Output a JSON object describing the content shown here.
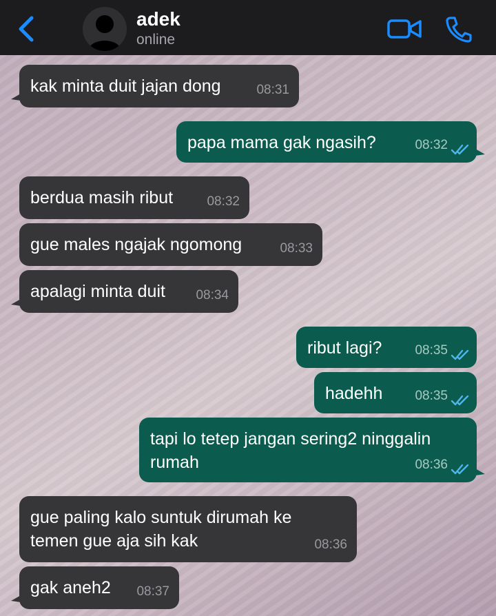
{
  "header": {
    "contact_name": "adek",
    "status": "online"
  },
  "colors": {
    "incoming_bubble": "#363638",
    "outgoing_bubble": "#0b5c4e",
    "accent": "#1a8cff",
    "read_tick": "#4fb6ec"
  },
  "messages": [
    {
      "direction": "in",
      "text": "kak minta duit jajan dong",
      "time": "08:31"
    },
    {
      "direction": "out",
      "text": "papa mama gak ngasih?",
      "time": "08:32",
      "status": "read"
    },
    {
      "direction": "in",
      "text": "berdua masih ribut",
      "time": "08:32"
    },
    {
      "direction": "in",
      "text": "gue males ngajak ngomong",
      "time": "08:33"
    },
    {
      "direction": "in",
      "text": "apalagi minta duit",
      "time": "08:34"
    },
    {
      "direction": "out",
      "text": "ribut lagi?",
      "time": "08:35",
      "status": "read"
    },
    {
      "direction": "out",
      "text": "hadehh",
      "time": "08:35",
      "status": "read"
    },
    {
      "direction": "out",
      "text": "tapi lo tetep jangan sering2 ninggalin rumah",
      "time": "08:36",
      "status": "read"
    },
    {
      "direction": "in",
      "text": "gue paling kalo suntuk dirumah ke temen gue aja sih kak",
      "time": "08:36"
    },
    {
      "direction": "in",
      "text": "gak aneh2",
      "time": "08:37"
    }
  ]
}
